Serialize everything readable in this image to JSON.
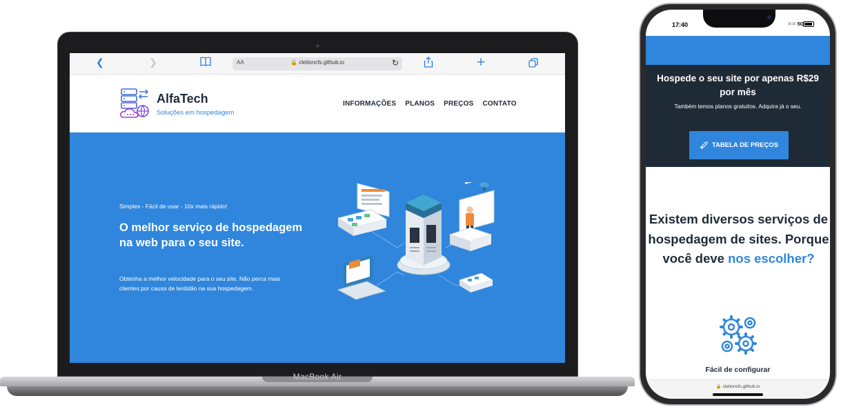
{
  "laptop": {
    "model_label": "MacBook Air",
    "browser": {
      "reader_label": "AA",
      "url": "cleitoncfs.github.io",
      "icons": [
        "chevron-left-icon",
        "chevron-right-icon",
        "book-icon",
        "lock-icon",
        "reload-icon",
        "share-icon",
        "plus-icon",
        "tabs-icon"
      ]
    },
    "site": {
      "brand": "AlfaTech",
      "tagline": "Soluções em hospedagem",
      "nav": [
        "INFORMAÇÕES",
        "PLANOS",
        "PREÇOS",
        "CONTATO"
      ],
      "hero": {
        "kicker": "Simples - Fácil de usar - 10x mais rápido!",
        "title": "O melhor serviço de hospedagem na web para o seu site.",
        "description": "Obtenha a melhor velocidade para o seu site. Não perca mais clientes por causa de lentidão na sua hospedagem."
      }
    }
  },
  "phone": {
    "status": {
      "time": "17:40",
      "network": "5G"
    },
    "promo": {
      "title": "Hospede o seu site por apenas R$29 por mês",
      "subtitle": "Também temos planos gratuitos. Adquira já o seu.",
      "button_label": "TABELA DE PREÇOS"
    },
    "section": {
      "heading_main": "Existem diversos serviços de hospedagem de sites. Porque você deve",
      "heading_highlight": "nos escolher?"
    },
    "feature_title": "Fácil de configurar",
    "url": "cleitoncfs.github.io"
  },
  "colors": {
    "accent_blue": "#2f86dc",
    "dark_navy": "#1f2a37",
    "white": "#ffffff"
  }
}
